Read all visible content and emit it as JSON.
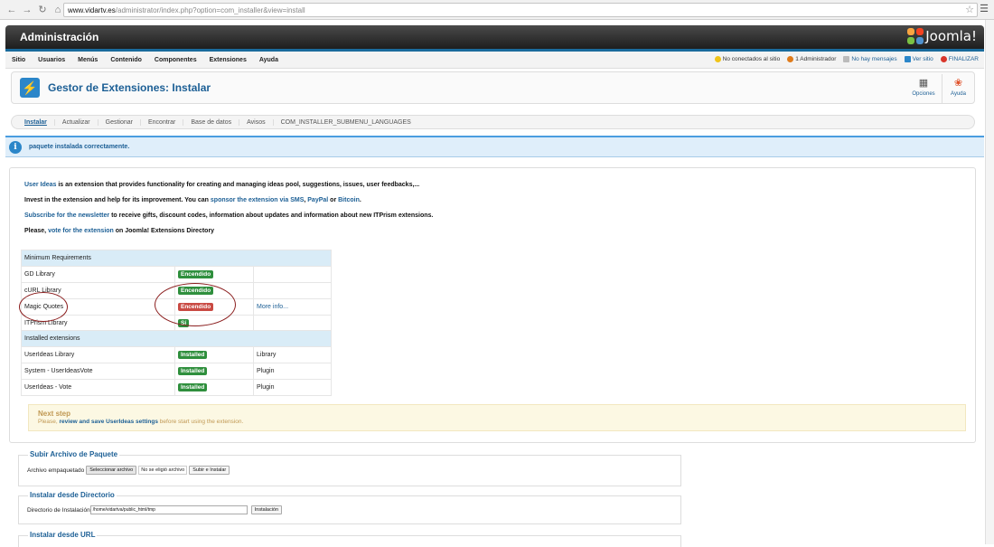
{
  "browser": {
    "url_host": "www.vidartv.es",
    "url_path": "/administrator/index.php?option=com_installer&view=install"
  },
  "header": {
    "title": "Administración",
    "logo_text": "Joomla!"
  },
  "topnav": {
    "items": [
      "Sitio",
      "Usuarios",
      "Menús",
      "Contenido",
      "Componentes",
      "Extensiones",
      "Ayuda"
    ],
    "status": {
      "offline": "No conectados al sitio",
      "admin": "1 Administrador",
      "messages": "No hay mensajes",
      "view_site": "Ver sitio",
      "logout": "FINALIZAR"
    }
  },
  "toolbar": {
    "page_title": "Gestor de Extensiones: Instalar",
    "options": "Opciones",
    "help": "Ayuda"
  },
  "tabs": [
    "Instalar",
    "Actualizar",
    "Gestionar",
    "Encontrar",
    "Base de datos",
    "Avisos",
    "COM_INSTALLER_SUBMENU_LANGUAGES"
  ],
  "message": "paquete instalada correctamente.",
  "intro": {
    "l1_link": "User Ideas",
    "l1_rest": " is an extension that provides functionality for creating and managing ideas pool, suggestions, issues, user feedbacks,...",
    "l2_pre": "Invest in the extension and help for its improvement. You can ",
    "l2_link1": "sponsor the extension via SMS",
    "l2_sep1": ", ",
    "l2_link2": "PayPal",
    "l2_sep2": " or ",
    "l2_link3": "Bitcoin",
    "l2_end": ".",
    "l3_link": "Subscribe for the newsletter",
    "l3_rest": " to receive gifts, discount codes, information about updates and information about new ITPrism extensions.",
    "l4_pre": "Please, ",
    "l4_link": "vote for the extension",
    "l4_rest": " on Joomla! Extensions Directory"
  },
  "requirements": {
    "header": "Minimum Requirements",
    "rows": [
      {
        "name": "GD Library",
        "status": "Encendido",
        "info": ""
      },
      {
        "name": "cURL Library",
        "status": "Encendido",
        "info": ""
      },
      {
        "name": "Magic Quotes",
        "status": "Encendido",
        "info": "More info..."
      },
      {
        "name": "ITPrism Library",
        "status": "Sí",
        "info": ""
      }
    ],
    "installed_header": "Installed extensions",
    "installed": [
      {
        "name": "UserIdeas Library",
        "status": "Installed",
        "type": "Library"
      },
      {
        "name": "System - UserIdeasVote",
        "status": "Installed",
        "type": "Plugin"
      },
      {
        "name": "UserIdeas - Vote",
        "status": "Installed",
        "type": "Plugin"
      }
    ]
  },
  "nextstep": {
    "title": "Next step",
    "pre": "Please, ",
    "link": "review and save UserIdeas settings",
    "post": " before start using the extension."
  },
  "upload": {
    "legend": "Subir Archivo de Paquete",
    "label": "Archivo empaquetado",
    "choose": "Seleccionar archivo",
    "nofile": "No se eligió archivo",
    "submit": "Subir e Instalar"
  },
  "directory": {
    "legend": "Instalar desde Directorio",
    "label": "Directorio de Instalación",
    "value": "/home/vidartva/public_html/tmp",
    "submit": "Instalación"
  },
  "url": {
    "legend": "Instalar desde URL"
  },
  "colors": {
    "accent": "#1c5f95",
    "ok": "#2f8f3d",
    "warn": "#c94a43",
    "annotation": "#8b1e1e"
  }
}
